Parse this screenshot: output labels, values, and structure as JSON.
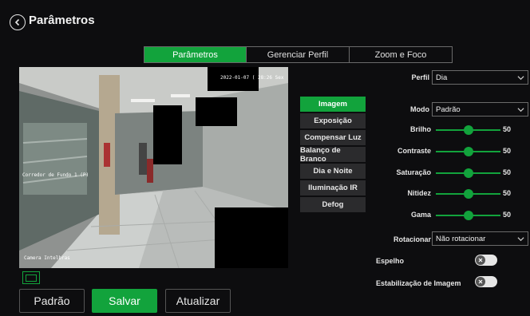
{
  "header": {
    "title": "Parâmetros"
  },
  "tabs": [
    {
      "label": "Parâmetros",
      "active": true
    },
    {
      "label": "Gerenciar Perfil",
      "active": false
    },
    {
      "label": "Zoom e Foco",
      "active": false
    }
  ],
  "preview": {
    "timestamp": "2022-01-07 ( 28:26 Sex",
    "caption_left": "Corredor de Fundo 1 (P)",
    "caption_bottom": "Camera Intelbras"
  },
  "side_menu": [
    {
      "label": "Imagem",
      "active": true
    },
    {
      "label": "Exposição",
      "active": false
    },
    {
      "label": "Compensar Luz",
      "active": false
    },
    {
      "label": "Balanço de Branco",
      "active": false
    },
    {
      "label": "Dia e Noite",
      "active": false
    },
    {
      "label": "Iluminação IR",
      "active": false
    },
    {
      "label": "Defog",
      "active": false
    }
  ],
  "settings": {
    "perfil": {
      "label": "Perfil",
      "value": "Dia"
    },
    "modo": {
      "label": "Modo",
      "value": "Padrão"
    },
    "sliders": [
      {
        "label": "Brilho",
        "value": 50
      },
      {
        "label": "Contraste",
        "value": 50
      },
      {
        "label": "Saturação",
        "value": 50
      },
      {
        "label": "Nitidez",
        "value": 50
      },
      {
        "label": "Gama",
        "value": 50
      }
    ],
    "rotacionar": {
      "label": "Rotacionar",
      "value": "Não rotacionar"
    },
    "espelho": {
      "label": "Espelho",
      "on": false
    },
    "estabilizacao": {
      "label": "Estabilização de Imagem",
      "on": false
    }
  },
  "buttons": {
    "padrao": "Padrão",
    "salvar": "Salvar",
    "atualizar": "Atualizar"
  },
  "colors": {
    "accent": "#12a33c",
    "background": "#0d0d0f"
  }
}
